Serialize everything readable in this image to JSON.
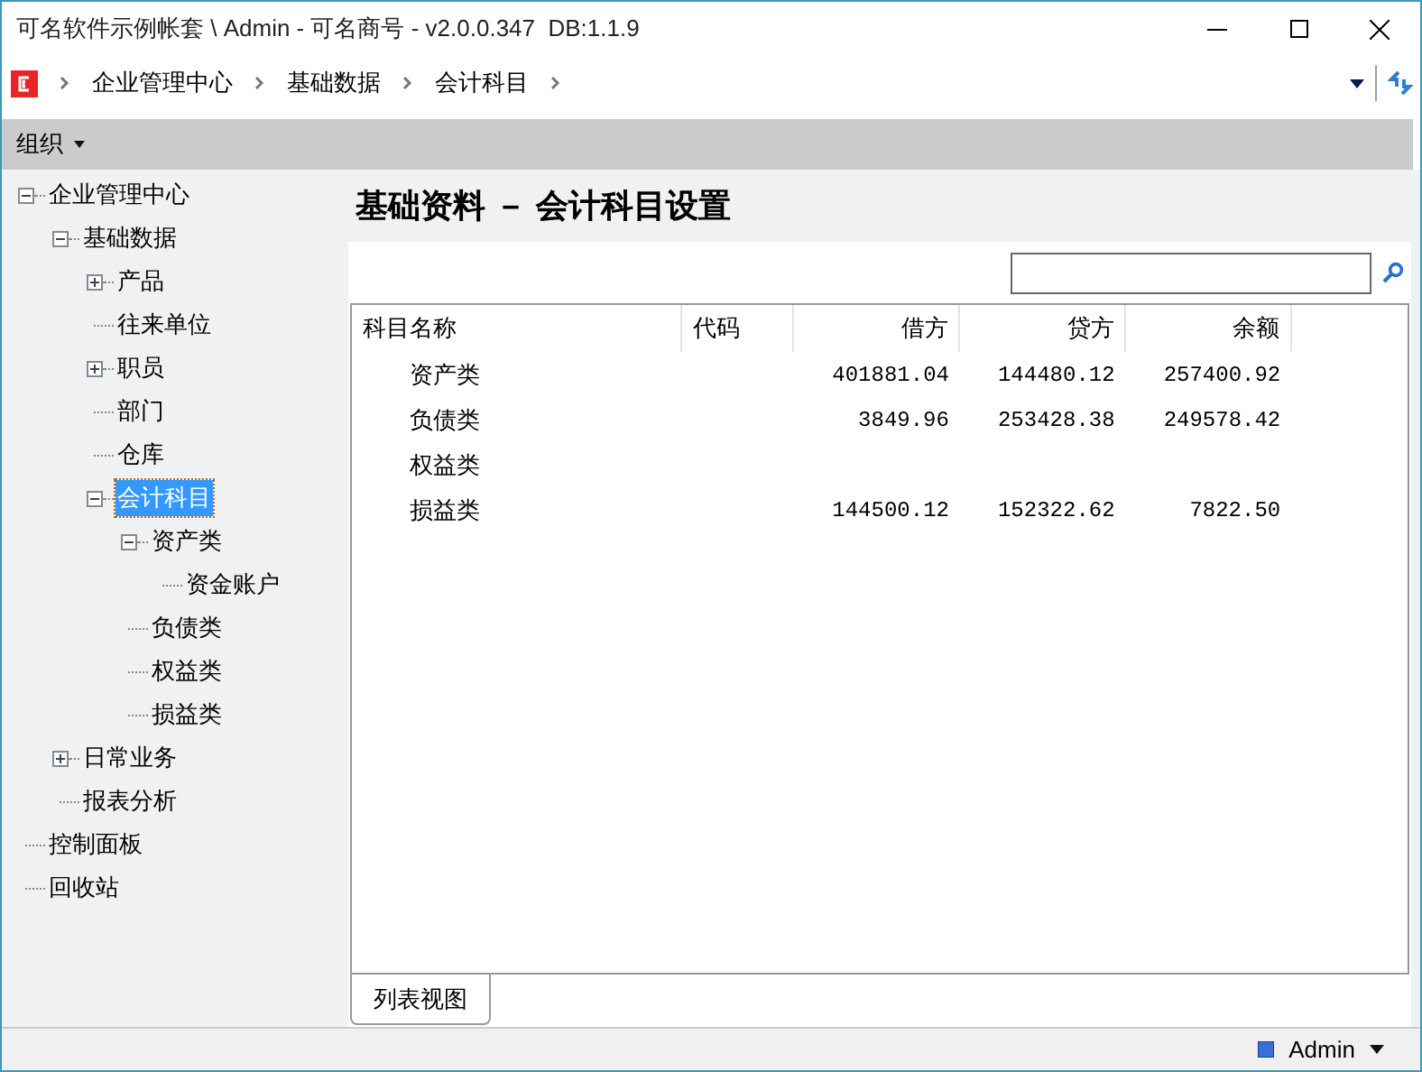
{
  "window": {
    "title": "可名软件示例帐套 \\ Admin - 可名商号 - v2.0.0.347  DB:1.1.9"
  },
  "breadcrumb": [
    "企业管理中心",
    "基础数据",
    "会计科目"
  ],
  "toolbar": {
    "menu": "组织"
  },
  "tree": [
    {
      "label": "企业管理中心",
      "expanded": true,
      "selected": false,
      "children": [
        {
          "label": "基础数据",
          "expanded": true,
          "selected": false,
          "children": [
            {
              "label": "产品",
              "expanded": false,
              "selected": false
            },
            {
              "label": "往来单位",
              "selected": false
            },
            {
              "label": "职员",
              "expanded": false,
              "selected": false
            },
            {
              "label": "部门",
              "selected": false
            },
            {
              "label": "仓库",
              "selected": false
            },
            {
              "label": "会计科目",
              "expanded": true,
              "selected": true,
              "children": [
                {
                  "label": "资产类",
                  "expanded": true,
                  "selected": false,
                  "children": [
                    {
                      "label": "资金账户",
                      "selected": false
                    }
                  ]
                },
                {
                  "label": "负债类",
                  "selected": false
                },
                {
                  "label": "权益类",
                  "selected": false
                },
                {
                  "label": "损益类",
                  "selected": false
                }
              ]
            }
          ]
        },
        {
          "label": "日常业务",
          "expanded": false,
          "selected": false
        },
        {
          "label": "报表分析",
          "selected": false
        }
      ]
    },
    {
      "label": "控制面板",
      "selected": false
    },
    {
      "label": "回收站",
      "selected": false
    }
  ],
  "content": {
    "title": "基础资料 － 会计科目设置",
    "table": {
      "columns": [
        "科目名称",
        "代码",
        "借方",
        "贷方",
        "余额"
      ],
      "rows": [
        [
          "资产类",
          "",
          "401881.04",
          "144480.12",
          "257400.92"
        ],
        [
          "负债类",
          "",
          "3849.96",
          "253428.38",
          "249578.42"
        ],
        [
          "权益类",
          "",
          "",
          "",
          ""
        ],
        [
          "损益类",
          "",
          "144500.12",
          "152322.62",
          "7822.50"
        ]
      ]
    },
    "tabs": [
      {
        "label": "列表视图",
        "selected": true
      }
    ]
  },
  "status_bar": {
    "user": "Admin"
  }
}
